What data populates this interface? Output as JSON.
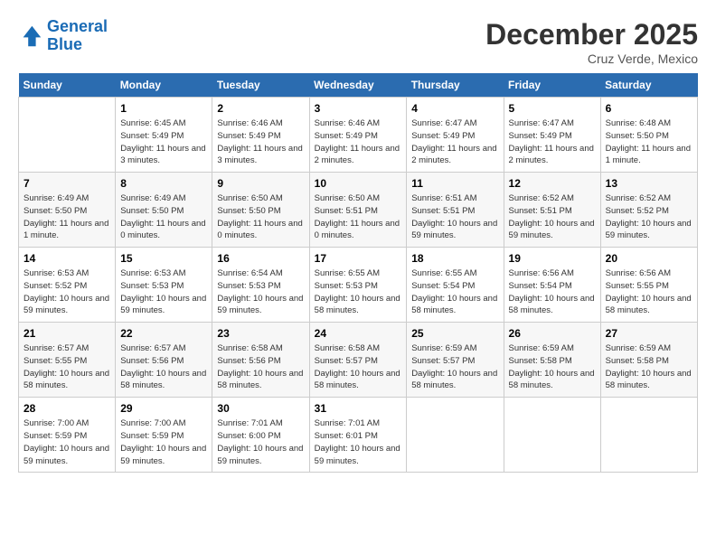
{
  "logo": {
    "line1": "General",
    "line2": "Blue"
  },
  "title": "December 2025",
  "location": "Cruz Verde, Mexico",
  "weekdays": [
    "Sunday",
    "Monday",
    "Tuesday",
    "Wednesday",
    "Thursday",
    "Friday",
    "Saturday"
  ],
  "weeks": [
    [
      {
        "day": "",
        "sunrise": "",
        "sunset": "",
        "daylight": ""
      },
      {
        "day": "1",
        "sunrise": "Sunrise: 6:45 AM",
        "sunset": "Sunset: 5:49 PM",
        "daylight": "Daylight: 11 hours and 3 minutes."
      },
      {
        "day": "2",
        "sunrise": "Sunrise: 6:46 AM",
        "sunset": "Sunset: 5:49 PM",
        "daylight": "Daylight: 11 hours and 3 minutes."
      },
      {
        "day": "3",
        "sunrise": "Sunrise: 6:46 AM",
        "sunset": "Sunset: 5:49 PM",
        "daylight": "Daylight: 11 hours and 2 minutes."
      },
      {
        "day": "4",
        "sunrise": "Sunrise: 6:47 AM",
        "sunset": "Sunset: 5:49 PM",
        "daylight": "Daylight: 11 hours and 2 minutes."
      },
      {
        "day": "5",
        "sunrise": "Sunrise: 6:47 AM",
        "sunset": "Sunset: 5:49 PM",
        "daylight": "Daylight: 11 hours and 2 minutes."
      },
      {
        "day": "6",
        "sunrise": "Sunrise: 6:48 AM",
        "sunset": "Sunset: 5:50 PM",
        "daylight": "Daylight: 11 hours and 1 minute."
      }
    ],
    [
      {
        "day": "7",
        "sunrise": "Sunrise: 6:49 AM",
        "sunset": "Sunset: 5:50 PM",
        "daylight": "Daylight: 11 hours and 1 minute."
      },
      {
        "day": "8",
        "sunrise": "Sunrise: 6:49 AM",
        "sunset": "Sunset: 5:50 PM",
        "daylight": "Daylight: 11 hours and 0 minutes."
      },
      {
        "day": "9",
        "sunrise": "Sunrise: 6:50 AM",
        "sunset": "Sunset: 5:50 PM",
        "daylight": "Daylight: 11 hours and 0 minutes."
      },
      {
        "day": "10",
        "sunrise": "Sunrise: 6:50 AM",
        "sunset": "Sunset: 5:51 PM",
        "daylight": "Daylight: 11 hours and 0 minutes."
      },
      {
        "day": "11",
        "sunrise": "Sunrise: 6:51 AM",
        "sunset": "Sunset: 5:51 PM",
        "daylight": "Daylight: 10 hours and 59 minutes."
      },
      {
        "day": "12",
        "sunrise": "Sunrise: 6:52 AM",
        "sunset": "Sunset: 5:51 PM",
        "daylight": "Daylight: 10 hours and 59 minutes."
      },
      {
        "day": "13",
        "sunrise": "Sunrise: 6:52 AM",
        "sunset": "Sunset: 5:52 PM",
        "daylight": "Daylight: 10 hours and 59 minutes."
      }
    ],
    [
      {
        "day": "14",
        "sunrise": "Sunrise: 6:53 AM",
        "sunset": "Sunset: 5:52 PM",
        "daylight": "Daylight: 10 hours and 59 minutes."
      },
      {
        "day": "15",
        "sunrise": "Sunrise: 6:53 AM",
        "sunset": "Sunset: 5:53 PM",
        "daylight": "Daylight: 10 hours and 59 minutes."
      },
      {
        "day": "16",
        "sunrise": "Sunrise: 6:54 AM",
        "sunset": "Sunset: 5:53 PM",
        "daylight": "Daylight: 10 hours and 59 minutes."
      },
      {
        "day": "17",
        "sunrise": "Sunrise: 6:55 AM",
        "sunset": "Sunset: 5:53 PM",
        "daylight": "Daylight: 10 hours and 58 minutes."
      },
      {
        "day": "18",
        "sunrise": "Sunrise: 6:55 AM",
        "sunset": "Sunset: 5:54 PM",
        "daylight": "Daylight: 10 hours and 58 minutes."
      },
      {
        "day": "19",
        "sunrise": "Sunrise: 6:56 AM",
        "sunset": "Sunset: 5:54 PM",
        "daylight": "Daylight: 10 hours and 58 minutes."
      },
      {
        "day": "20",
        "sunrise": "Sunrise: 6:56 AM",
        "sunset": "Sunset: 5:55 PM",
        "daylight": "Daylight: 10 hours and 58 minutes."
      }
    ],
    [
      {
        "day": "21",
        "sunrise": "Sunrise: 6:57 AM",
        "sunset": "Sunset: 5:55 PM",
        "daylight": "Daylight: 10 hours and 58 minutes."
      },
      {
        "day": "22",
        "sunrise": "Sunrise: 6:57 AM",
        "sunset": "Sunset: 5:56 PM",
        "daylight": "Daylight: 10 hours and 58 minutes."
      },
      {
        "day": "23",
        "sunrise": "Sunrise: 6:58 AM",
        "sunset": "Sunset: 5:56 PM",
        "daylight": "Daylight: 10 hours and 58 minutes."
      },
      {
        "day": "24",
        "sunrise": "Sunrise: 6:58 AM",
        "sunset": "Sunset: 5:57 PM",
        "daylight": "Daylight: 10 hours and 58 minutes."
      },
      {
        "day": "25",
        "sunrise": "Sunrise: 6:59 AM",
        "sunset": "Sunset: 5:57 PM",
        "daylight": "Daylight: 10 hours and 58 minutes."
      },
      {
        "day": "26",
        "sunrise": "Sunrise: 6:59 AM",
        "sunset": "Sunset: 5:58 PM",
        "daylight": "Daylight: 10 hours and 58 minutes."
      },
      {
        "day": "27",
        "sunrise": "Sunrise: 6:59 AM",
        "sunset": "Sunset: 5:58 PM",
        "daylight": "Daylight: 10 hours and 58 minutes."
      }
    ],
    [
      {
        "day": "28",
        "sunrise": "Sunrise: 7:00 AM",
        "sunset": "Sunset: 5:59 PM",
        "daylight": "Daylight: 10 hours and 59 minutes."
      },
      {
        "day": "29",
        "sunrise": "Sunrise: 7:00 AM",
        "sunset": "Sunset: 5:59 PM",
        "daylight": "Daylight: 10 hours and 59 minutes."
      },
      {
        "day": "30",
        "sunrise": "Sunrise: 7:01 AM",
        "sunset": "Sunset: 6:00 PM",
        "daylight": "Daylight: 10 hours and 59 minutes."
      },
      {
        "day": "31",
        "sunrise": "Sunrise: 7:01 AM",
        "sunset": "Sunset: 6:01 PM",
        "daylight": "Daylight: 10 hours and 59 minutes."
      },
      {
        "day": "",
        "sunrise": "",
        "sunset": "",
        "daylight": ""
      },
      {
        "day": "",
        "sunrise": "",
        "sunset": "",
        "daylight": ""
      },
      {
        "day": "",
        "sunrise": "",
        "sunset": "",
        "daylight": ""
      }
    ]
  ]
}
